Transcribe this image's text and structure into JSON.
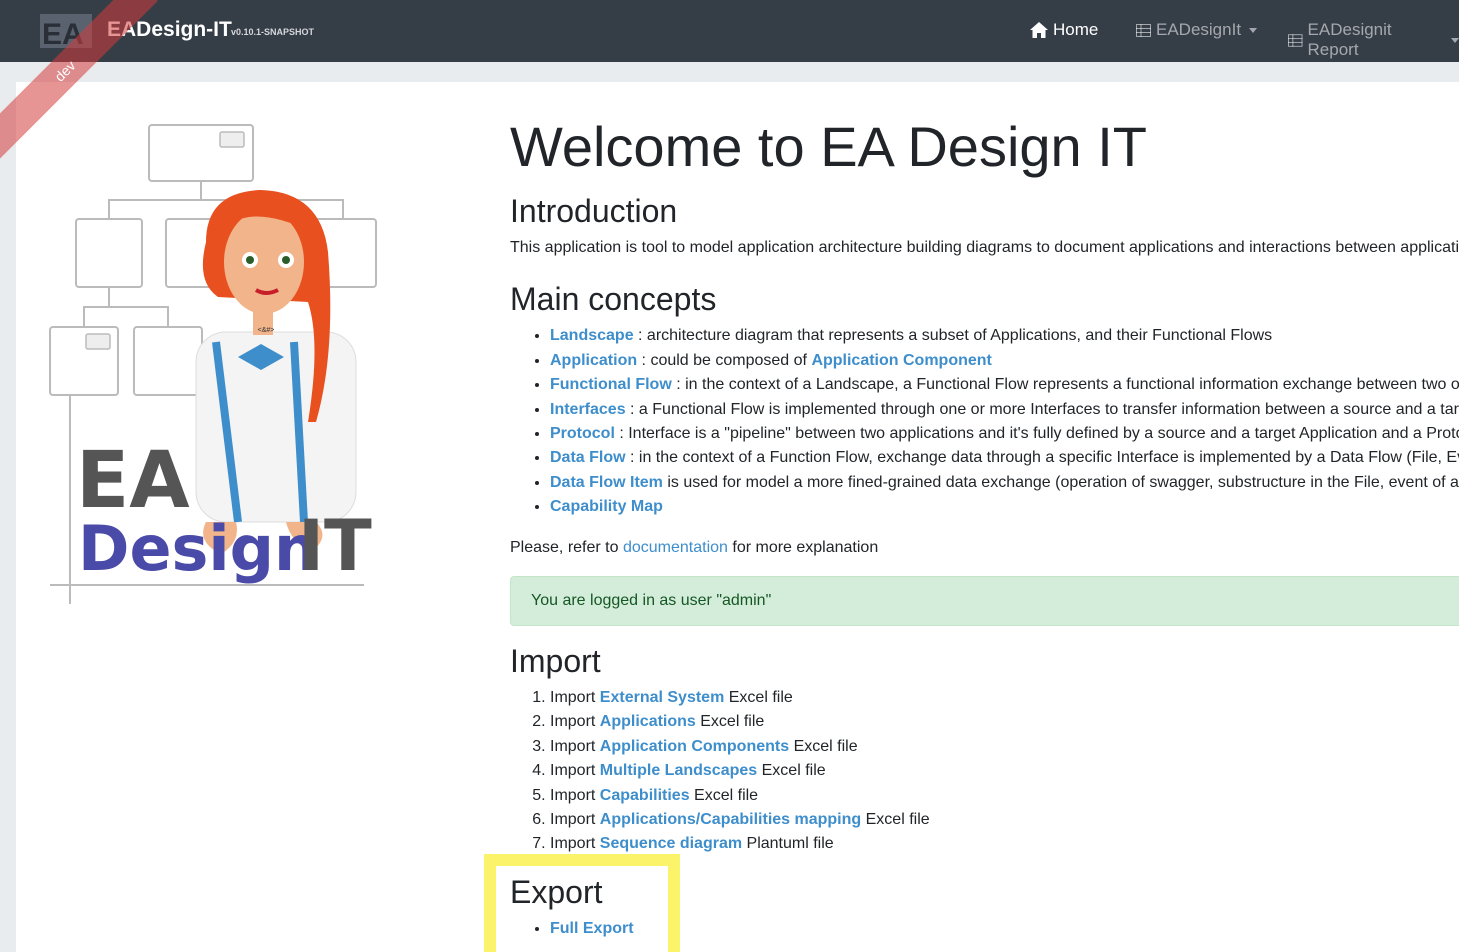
{
  "navbar": {
    "brand_name": "EADesign-IT",
    "brand_version": "v0.10.1-SNAPSHOT",
    "ribbon": "dev",
    "items": [
      {
        "label": "Home",
        "icon": "home-icon"
      },
      {
        "label": "EADesignIt",
        "icon": "table-icon"
      },
      {
        "label": "EADesignit Report",
        "icon": "table-icon"
      }
    ]
  },
  "illustration": {
    "text_line1": "EA",
    "text_line2": "Design",
    "text_line3": "IT",
    "badge": "<&#>"
  },
  "main": {
    "title": "Welcome to EA Design IT",
    "intro_heading": "Introduction",
    "intro_text": "This application is tool to model application architecture building diagrams to document applications and interactions between applications",
    "concepts_heading": "Main concepts",
    "concepts": [
      {
        "link": "Landscape",
        "text": " : architecture diagram that represents a subset of Applications, and their Functional Flows"
      },
      {
        "link": "Application",
        "text": " : could be composed of ",
        "link2": "Application Component"
      },
      {
        "link": "Functional Flow",
        "text": " : in the context of a Landscape, a Functional Flow represents a functional information exchange between two or more applications"
      },
      {
        "link": "Interfaces",
        "text": " : a Functional Flow is implemented through one or more Interfaces to transfer information between a source and a target"
      },
      {
        "link": "Protocol",
        "text": " : Interface is a \"pipeline\" between two applications and it's fully defined by a source and a target Application and a Protocol"
      },
      {
        "link": "Data Flow",
        "text": " : in the context of a Function Flow, exchange data through a specific Interface is implemented by a Data Flow (File, Event, API)"
      },
      {
        "link": "Data Flow Item",
        "text": " is used for model a more fined-grained data exchange (operation of swagger, substructure in the File, event of a topic)"
      },
      {
        "link": "Capability Map",
        "text": ""
      }
    ],
    "refer_prefix": "Please, refer to ",
    "refer_link": "documentation",
    "refer_suffix": " for more explanation",
    "alert": "You are logged in as user \"admin\"",
    "import_heading": "Import",
    "imports": [
      {
        "prefix": "Import ",
        "link": "External System",
        "suffix": " Excel file"
      },
      {
        "prefix": "Import ",
        "link": "Applications",
        "suffix": " Excel file"
      },
      {
        "prefix": "Import ",
        "link": "Application Components",
        "suffix": " Excel file"
      },
      {
        "prefix": "Import ",
        "link": "Multiple Landscapes",
        "suffix": " Excel file"
      },
      {
        "prefix": "Import ",
        "link": "Capabilities",
        "suffix": " Excel file"
      },
      {
        "prefix": "Import ",
        "link": "Applications/Capabilities mapping",
        "suffix": " Excel file"
      },
      {
        "prefix": "Import ",
        "link": "Sequence diagram",
        "suffix": " Plantuml file"
      }
    ],
    "export_heading": "Export",
    "exports": [
      {
        "link": "Full Export"
      }
    ]
  },
  "colors": {
    "navbar_bg": "#353d47",
    "link": "#3e8ecc",
    "alert_bg": "#d4edda",
    "highlight": "#fbf36a",
    "logo_purple": "#4a4aa8"
  }
}
